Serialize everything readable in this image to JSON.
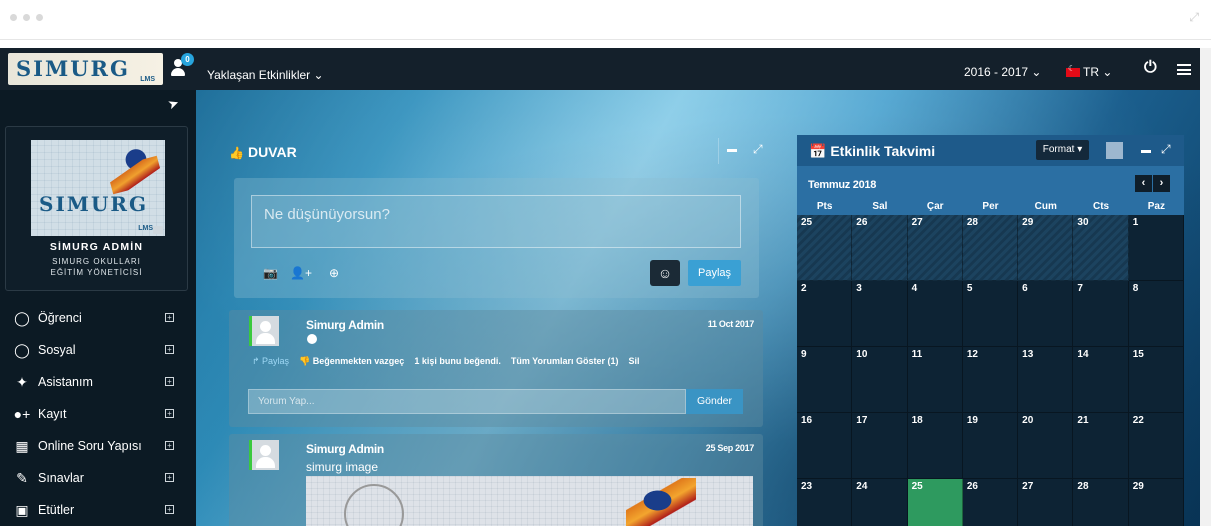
{
  "topbar": {
    "logo_text": "SIMURG",
    "logo_sub": "LMS",
    "notification_count": "0",
    "upcoming_events": "Yaklaşan Etkinlikler ⌄",
    "academic_year": "2016 - 2017 ⌄",
    "language": "TR ⌄"
  },
  "profile": {
    "name": "SİMURG ADMİN",
    "role_line1": "SIMURG OKULLARI",
    "role_line2": "EĞİTİM YÖNETİCİSİ",
    "avatar_text": "SIMURG",
    "avatar_sub": "LMS"
  },
  "menu": [
    {
      "label": "Öğrenci",
      "icon": "user-outline-icon",
      "glyph": "👤"
    },
    {
      "label": "Sosyal",
      "icon": "comments-icon",
      "glyph": "💬"
    },
    {
      "label": "Asistanım",
      "icon": "magic-wand-icon",
      "glyph": "✨"
    },
    {
      "label": "Kayıt",
      "icon": "user-plus-icon",
      "glyph": "👥"
    },
    {
      "label": "Online Soru Yapısı",
      "icon": "qrcode-icon",
      "glyph": "▦"
    },
    {
      "label": "Sınavlar",
      "icon": "edit-icon",
      "glyph": "✎"
    },
    {
      "label": "Etütler",
      "icon": "calendar-check-icon",
      "glyph": "📅"
    }
  ],
  "wall": {
    "title": "DUVAR",
    "composer_placeholder": "Ne düşünüyorsun?",
    "share_label": "Paylaş"
  },
  "posts": [
    {
      "author": "Simurg Admin",
      "date": "11 Oct 2017",
      "actions": {
        "share": "↱ Paylaş",
        "unlike": "👎 Beğenmekten vazgeç",
        "likes": "1 kişi bunu beğendi.",
        "show_comments": "Tüm Yorumları Göster (1)",
        "delete": "Sil"
      },
      "comment_placeholder": "Yorum Yap...",
      "send_label": "Gönder"
    },
    {
      "author": "Simurg Admin",
      "date": "25 Sep 2017",
      "caption": "simurg image"
    }
  ],
  "calendar": {
    "title": "Etkinlik Takvimi",
    "format_label": "Format ▾",
    "month": "Temmuz 2018",
    "weekdays": [
      "Pts",
      "Sal",
      "Çar",
      "Per",
      "Cum",
      "Cts",
      "Paz"
    ],
    "weeks": [
      [
        "25",
        "26",
        "27",
        "28",
        "29",
        "30",
        "1"
      ],
      [
        "2",
        "3",
        "4",
        "5",
        "6",
        "7",
        "8"
      ],
      [
        "9",
        "10",
        "11",
        "12",
        "13",
        "14",
        "15"
      ],
      [
        "16",
        "17",
        "18",
        "19",
        "20",
        "21",
        "22"
      ],
      [
        "23",
        "24",
        "25",
        "26",
        "27",
        "28",
        "29"
      ]
    ],
    "today": "25",
    "colors": {
      "today": "#2e9a5f",
      "header": "#1e5a8a",
      "accent": "#3aa0d4"
    }
  }
}
